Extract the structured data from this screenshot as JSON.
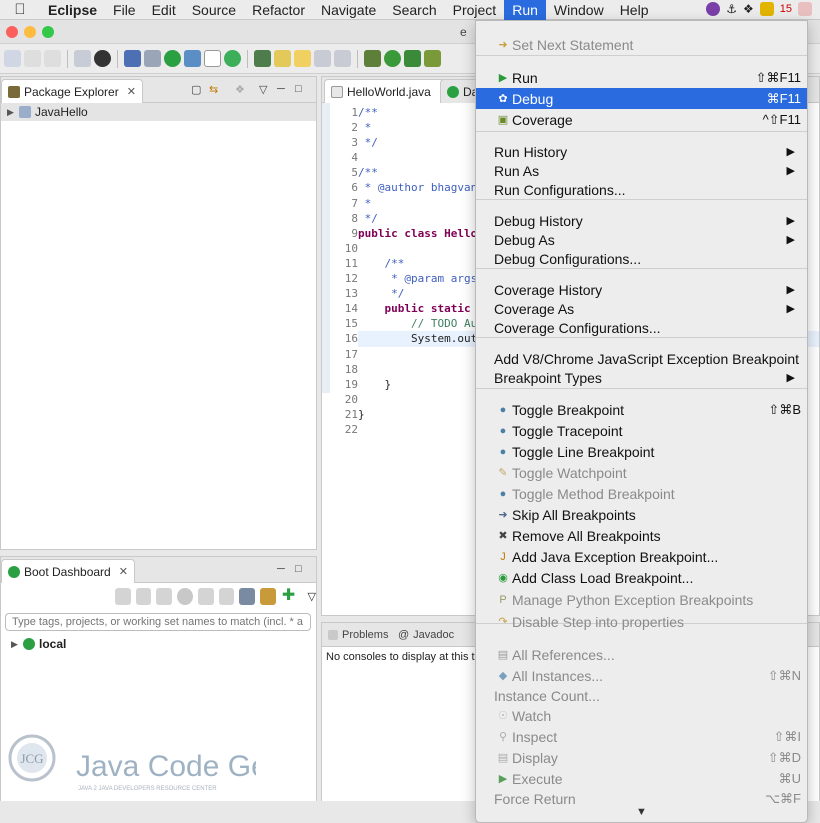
{
  "menubar": {
    "app": "Eclipse",
    "items": [
      "File",
      "Edit",
      "Source",
      "Refactor",
      "Navigate",
      "Search",
      "Project",
      "Run",
      "Window",
      "Help"
    ],
    "active": "Run",
    "tray_badge": "15"
  },
  "window_title_fragment": "e",
  "package_explorer": {
    "title": "Package Explorer",
    "items": [
      {
        "label": "JavaHello"
      }
    ]
  },
  "editor": {
    "tabs": [
      "HelloWorld.java",
      "Das"
    ],
    "lines": [
      "1",
      "2",
      "3",
      "4",
      "5",
      "6",
      "7",
      "8",
      "9",
      "10",
      "11",
      "12",
      "13",
      "14",
      "15",
      "16",
      "17",
      "18",
      "19",
      "20",
      "21",
      "22"
    ],
    "code": [
      "/**",
      " *",
      " */",
      "",
      "/**",
      " * @author bhagvan.k",
      " *",
      " */",
      "public class HelloWo",
      "",
      "    /**",
      "     * @param args",
      "     */",
      "    public static vo",
      "        // TODO Auto",
      "        System.out.p",
      "",
      "",
      "    }",
      "",
      "}",
      ""
    ]
  },
  "boot_dashboard": {
    "title": "Boot Dashboard",
    "filter_placeholder": "Type tags, projects, or working set names to match (incl. * a",
    "items": [
      {
        "label": "local"
      }
    ]
  },
  "console": {
    "tabs": [
      "Problems",
      "Javadoc"
    ],
    "message": "No consoles to display at this tim"
  },
  "run_menu": {
    "items": [
      {
        "label": "Set Next Statement",
        "icon": "arrow-icon",
        "disabled": true
      },
      {
        "label": "Run",
        "icon": "run-icon",
        "shortcut": "⇧⌘F11"
      },
      {
        "label": "Debug",
        "icon": "debug-bug-icon",
        "shortcut": "⌘F11",
        "highlighted": true
      },
      {
        "label": "Coverage",
        "icon": "coverage-icon",
        "shortcut": "^⇧F11"
      },
      {
        "label": "Run History",
        "submenu": true
      },
      {
        "label": "Run As",
        "submenu": true
      },
      {
        "label": "Run Configurations..."
      },
      {
        "label": "Debug History",
        "submenu": true
      },
      {
        "label": "Debug As",
        "submenu": true
      },
      {
        "label": "Debug Configurations..."
      },
      {
        "label": "Coverage History",
        "submenu": true
      },
      {
        "label": "Coverage As",
        "submenu": true
      },
      {
        "label": "Coverage Configurations..."
      },
      {
        "label": "Add V8/Chrome JavaScript Exception Breakpoint"
      },
      {
        "label": "Breakpoint Types",
        "submenu": true
      },
      {
        "label": "Toggle Breakpoint",
        "icon": "breakpoint-dot-icon",
        "shortcut": "⇧⌘B"
      },
      {
        "label": "Toggle Tracepoint",
        "icon": "breakpoint-dot-icon"
      },
      {
        "label": "Toggle Line Breakpoint",
        "icon": "breakpoint-dot-icon"
      },
      {
        "label": "Toggle Watchpoint",
        "icon": "watchpoint-icon",
        "disabled": true
      },
      {
        "label": "Toggle Method Breakpoint",
        "icon": "breakpoint-dot-icon",
        "disabled": true
      },
      {
        "label": "Skip All Breakpoints",
        "icon": "skip-breakpoints-icon"
      },
      {
        "label": "Remove All Breakpoints",
        "icon": "remove-breakpoints-icon"
      },
      {
        "label": "Add Java Exception Breakpoint...",
        "icon": "exception-breakpoint-icon"
      },
      {
        "label": "Add Class Load Breakpoint...",
        "icon": "class-load-icon"
      },
      {
        "label": "Manage Python Exception Breakpoints",
        "icon": "python-icon",
        "disabled": true
      },
      {
        "label": "Disable Step into properties",
        "icon": "step-into-icon",
        "disabled": true
      },
      {
        "label": "All References...",
        "icon": "references-icon",
        "disabled": true
      },
      {
        "label": "All Instances...",
        "icon": "instances-icon",
        "shortcut": "⇧⌘N",
        "disabled": true
      },
      {
        "label": "Instance Count...",
        "disabled": true
      },
      {
        "label": "Watch",
        "icon": "watch-icon",
        "disabled": true
      },
      {
        "label": "Inspect",
        "icon": "inspect-icon",
        "shortcut": "⇧⌘I",
        "disabled": true
      },
      {
        "label": "Display",
        "icon": "display-icon",
        "shortcut": "⇧⌘D",
        "disabled": true
      },
      {
        "label": "Execute",
        "icon": "execute-icon",
        "shortcut": "⌘U",
        "disabled": true
      },
      {
        "label": "Force Return",
        "shortcut": "⌥⌘F",
        "disabled": true
      }
    ],
    "scroll_arrow": "▼"
  },
  "logo": {
    "text": "Java Code Geeks",
    "tagline": "JAVA 2 JAVA DEVELOPERS RESOURCE CENTER",
    "badge": "JCG"
  },
  "colors": {
    "highlight": "#2a6cdf",
    "menu_bg": "#ededed",
    "keyword": "#7f0055",
    "javadoc": "#3f5fbf"
  }
}
